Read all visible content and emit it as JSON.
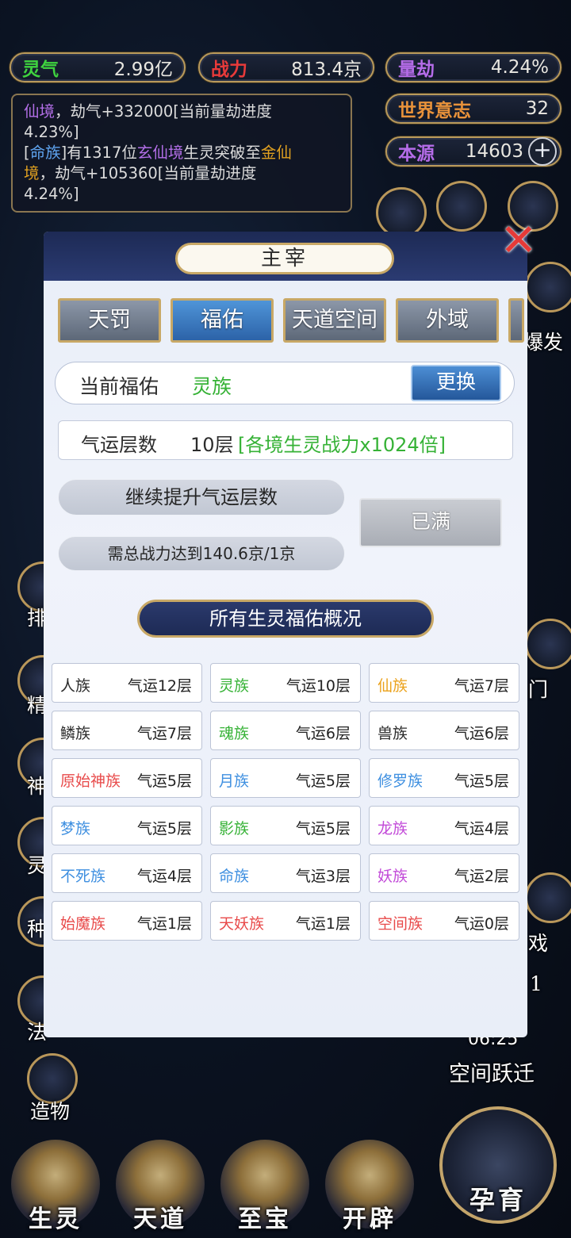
{
  "stats": {
    "lingqi": {
      "label": "灵气",
      "value": "2.99亿",
      "color": "#3fd33f"
    },
    "zhanli": {
      "label": "战力",
      "value": "813.4京",
      "color": "#e83a3a"
    },
    "liangjie": {
      "label": "量劫",
      "value": "4.24%",
      "color": "#b56ce8"
    },
    "shijie": {
      "label": "世界意志",
      "value": "32",
      "color": "#e8923a"
    },
    "benyuan": {
      "label": "本源",
      "value": "14603",
      "color": "#b56ce8"
    }
  },
  "log": {
    "l1_a": "仙境",
    "l1_b": "，劫气+332000[当前量劫进度",
    "l2": "4.23%]",
    "l3_a": "[",
    "l3_b": "命族",
    "l3_c": "]有1317位",
    "l3_d": "玄仙境",
    "l3_e": "生灵突破至",
    "l3_f": "金仙",
    "l4_a": "境",
    "l4_b": "，劫气+105360[当前量劫进度",
    "l5": "4.24%]"
  },
  "background": {
    "right_label_1": "爆发",
    "right_label_2": "门",
    "right_label_3": "戏",
    "right_label_4": "1",
    "timer": "06:25",
    "space_jump": "空间跃迁",
    "create": "造物",
    "left_labels": [
      "排",
      "精",
      "神",
      "灵",
      "种",
      "法"
    ],
    "bottom": [
      "生灵",
      "天道",
      "至宝",
      "开辟"
    ],
    "breed": "孕育"
  },
  "modal": {
    "title": "主宰",
    "tabs": [
      "天罚",
      "福佑",
      "天道空间",
      "外域"
    ],
    "active_tab": "福佑",
    "current_label": "当前福佑",
    "current_value": "灵族",
    "change_button": "更换",
    "luck_label": "气运层数",
    "luck_value": "10层",
    "luck_effect": "[各境生灵战力x1024倍]",
    "upgrade_label": "继续提升气运层数",
    "requirement": "需总战力达到140.6京/1京",
    "full_button": "已满",
    "overview_title": "所有生灵福佑概况",
    "races": [
      {
        "name": "人族",
        "level": "气运12层",
        "color": "#2a2a2a"
      },
      {
        "name": "灵族",
        "level": "气运10层",
        "color": "#36b236"
      },
      {
        "name": "仙族",
        "level": "气运7层",
        "color": "#eba21c"
      },
      {
        "name": "鳞族",
        "level": "气运7层",
        "color": "#2a2a2a"
      },
      {
        "name": "魂族",
        "level": "气运6层",
        "color": "#36b236"
      },
      {
        "name": "兽族",
        "level": "气运6层",
        "color": "#2a2a2a"
      },
      {
        "name": "原始神族",
        "level": "气运5层",
        "color": "#e84a4a"
      },
      {
        "name": "月族",
        "level": "气运5层",
        "color": "#3e8fe0"
      },
      {
        "name": "修罗族",
        "level": "气运5层",
        "color": "#3e8fe0"
      },
      {
        "name": "梦族",
        "level": "气运5层",
        "color": "#3e8fe0"
      },
      {
        "name": "影族",
        "level": "气运5层",
        "color": "#36b236"
      },
      {
        "name": "龙族",
        "level": "气运4层",
        "color": "#c24ad8"
      },
      {
        "name": "不死族",
        "level": "气运4层",
        "color": "#3e8fe0"
      },
      {
        "name": "命族",
        "level": "气运3层",
        "color": "#3e8fe0"
      },
      {
        "name": "妖族",
        "level": "气运2层",
        "color": "#c24ad8"
      },
      {
        "name": "始魔族",
        "level": "气运1层",
        "color": "#e84a4a"
      },
      {
        "name": "天妖族",
        "level": "气运1层",
        "color": "#e84a4a"
      },
      {
        "name": "空间族",
        "level": "气运0层",
        "color": "#e84a4a"
      }
    ]
  }
}
